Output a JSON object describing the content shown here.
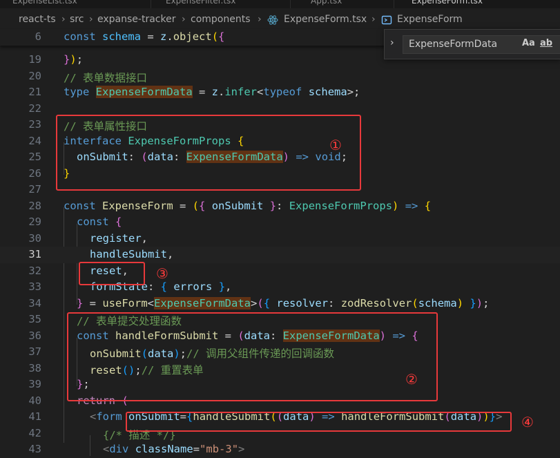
{
  "tabs": [
    {
      "label": "ExpenseList.tsx"
    },
    {
      "label": "ExpenseFilter.tsx"
    },
    {
      "label": "App.tsx"
    },
    {
      "label": "ExpenseForm.tsx"
    }
  ],
  "breadcrumb": {
    "items": [
      "react-ts",
      "src",
      "expanse-tracker",
      "components",
      "ExpenseForm.tsx",
      "ExpenseForm"
    ]
  },
  "find_widget": {
    "value": "ExpenseFormData",
    "match_case": "Aa",
    "match_word": "ab"
  },
  "sticky_line": {
    "number": "6"
  },
  "line_numbers": [
    "19",
    "20",
    "21",
    "22",
    "23",
    "24",
    "25",
    "26",
    "27",
    "28",
    "29",
    "30",
    "31",
    "32",
    "33",
    "34",
    "35",
    "36",
    "37",
    "38",
    "39",
    "40",
    "41",
    "42",
    "43"
  ],
  "active_line": "31",
  "annotations": [
    "①",
    "②",
    "③",
    "④"
  ],
  "code": {
    "comment_form_data": "// 表单数据接口",
    "comment_props": "// 表单属性接口",
    "comment_handler": "// 表单提交处理函数",
    "comment_call_parent": "// 调用父组件传递的回调函数",
    "comment_reset": "// 重置表单",
    "comment_desc": "{/* 描述 */}",
    "classname_value": "\"mb-3\""
  }
}
